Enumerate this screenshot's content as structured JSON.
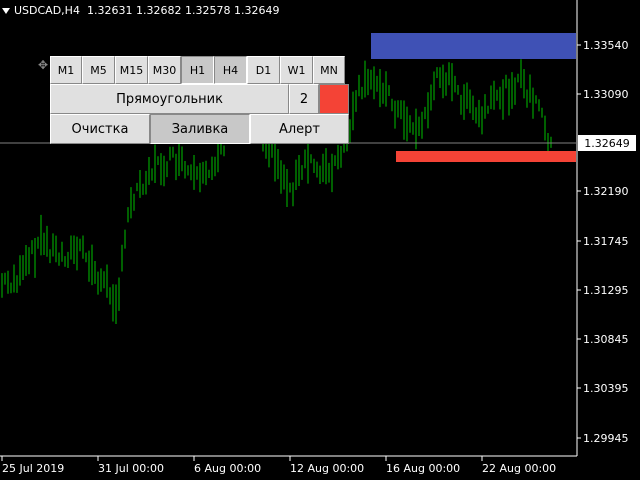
{
  "header": {
    "symbol": "USDCAD,H4",
    "open": "1.32631",
    "high": "1.32682",
    "low": "1.32578",
    "close": "1.32649"
  },
  "price_axis": [
    "1.33540",
    "1.33090",
    "1.32649",
    "1.32190",
    "1.31745",
    "1.31295",
    "1.30845",
    "1.30395",
    "1.29945"
  ],
  "current_price": "1.32649",
  "time_axis": [
    "25 Jul 2019",
    "31 Jul 00:00",
    "6 Aug 00:00",
    "12 Aug 00:00",
    "16 Aug 00:00",
    "22 Aug 00:00"
  ],
  "panel": {
    "timeframes": [
      "M1",
      "M5",
      "M15",
      "M30",
      "H1",
      "H4",
      "D1",
      "W1",
      "MN"
    ],
    "active_timeframes": [
      "H1",
      "H4"
    ],
    "shape_label": "Прямоугольник",
    "width_value": "2",
    "clear_label": "Очистка",
    "fill_label": "Заливка",
    "alert_label": "Алерт"
  },
  "colors": {
    "background": "#000000",
    "candles": "#00c000",
    "resistance_zone": "#3f51b5",
    "support_zone": "#f44336",
    "swatch": "#f44336",
    "price_line": "#808080"
  }
}
